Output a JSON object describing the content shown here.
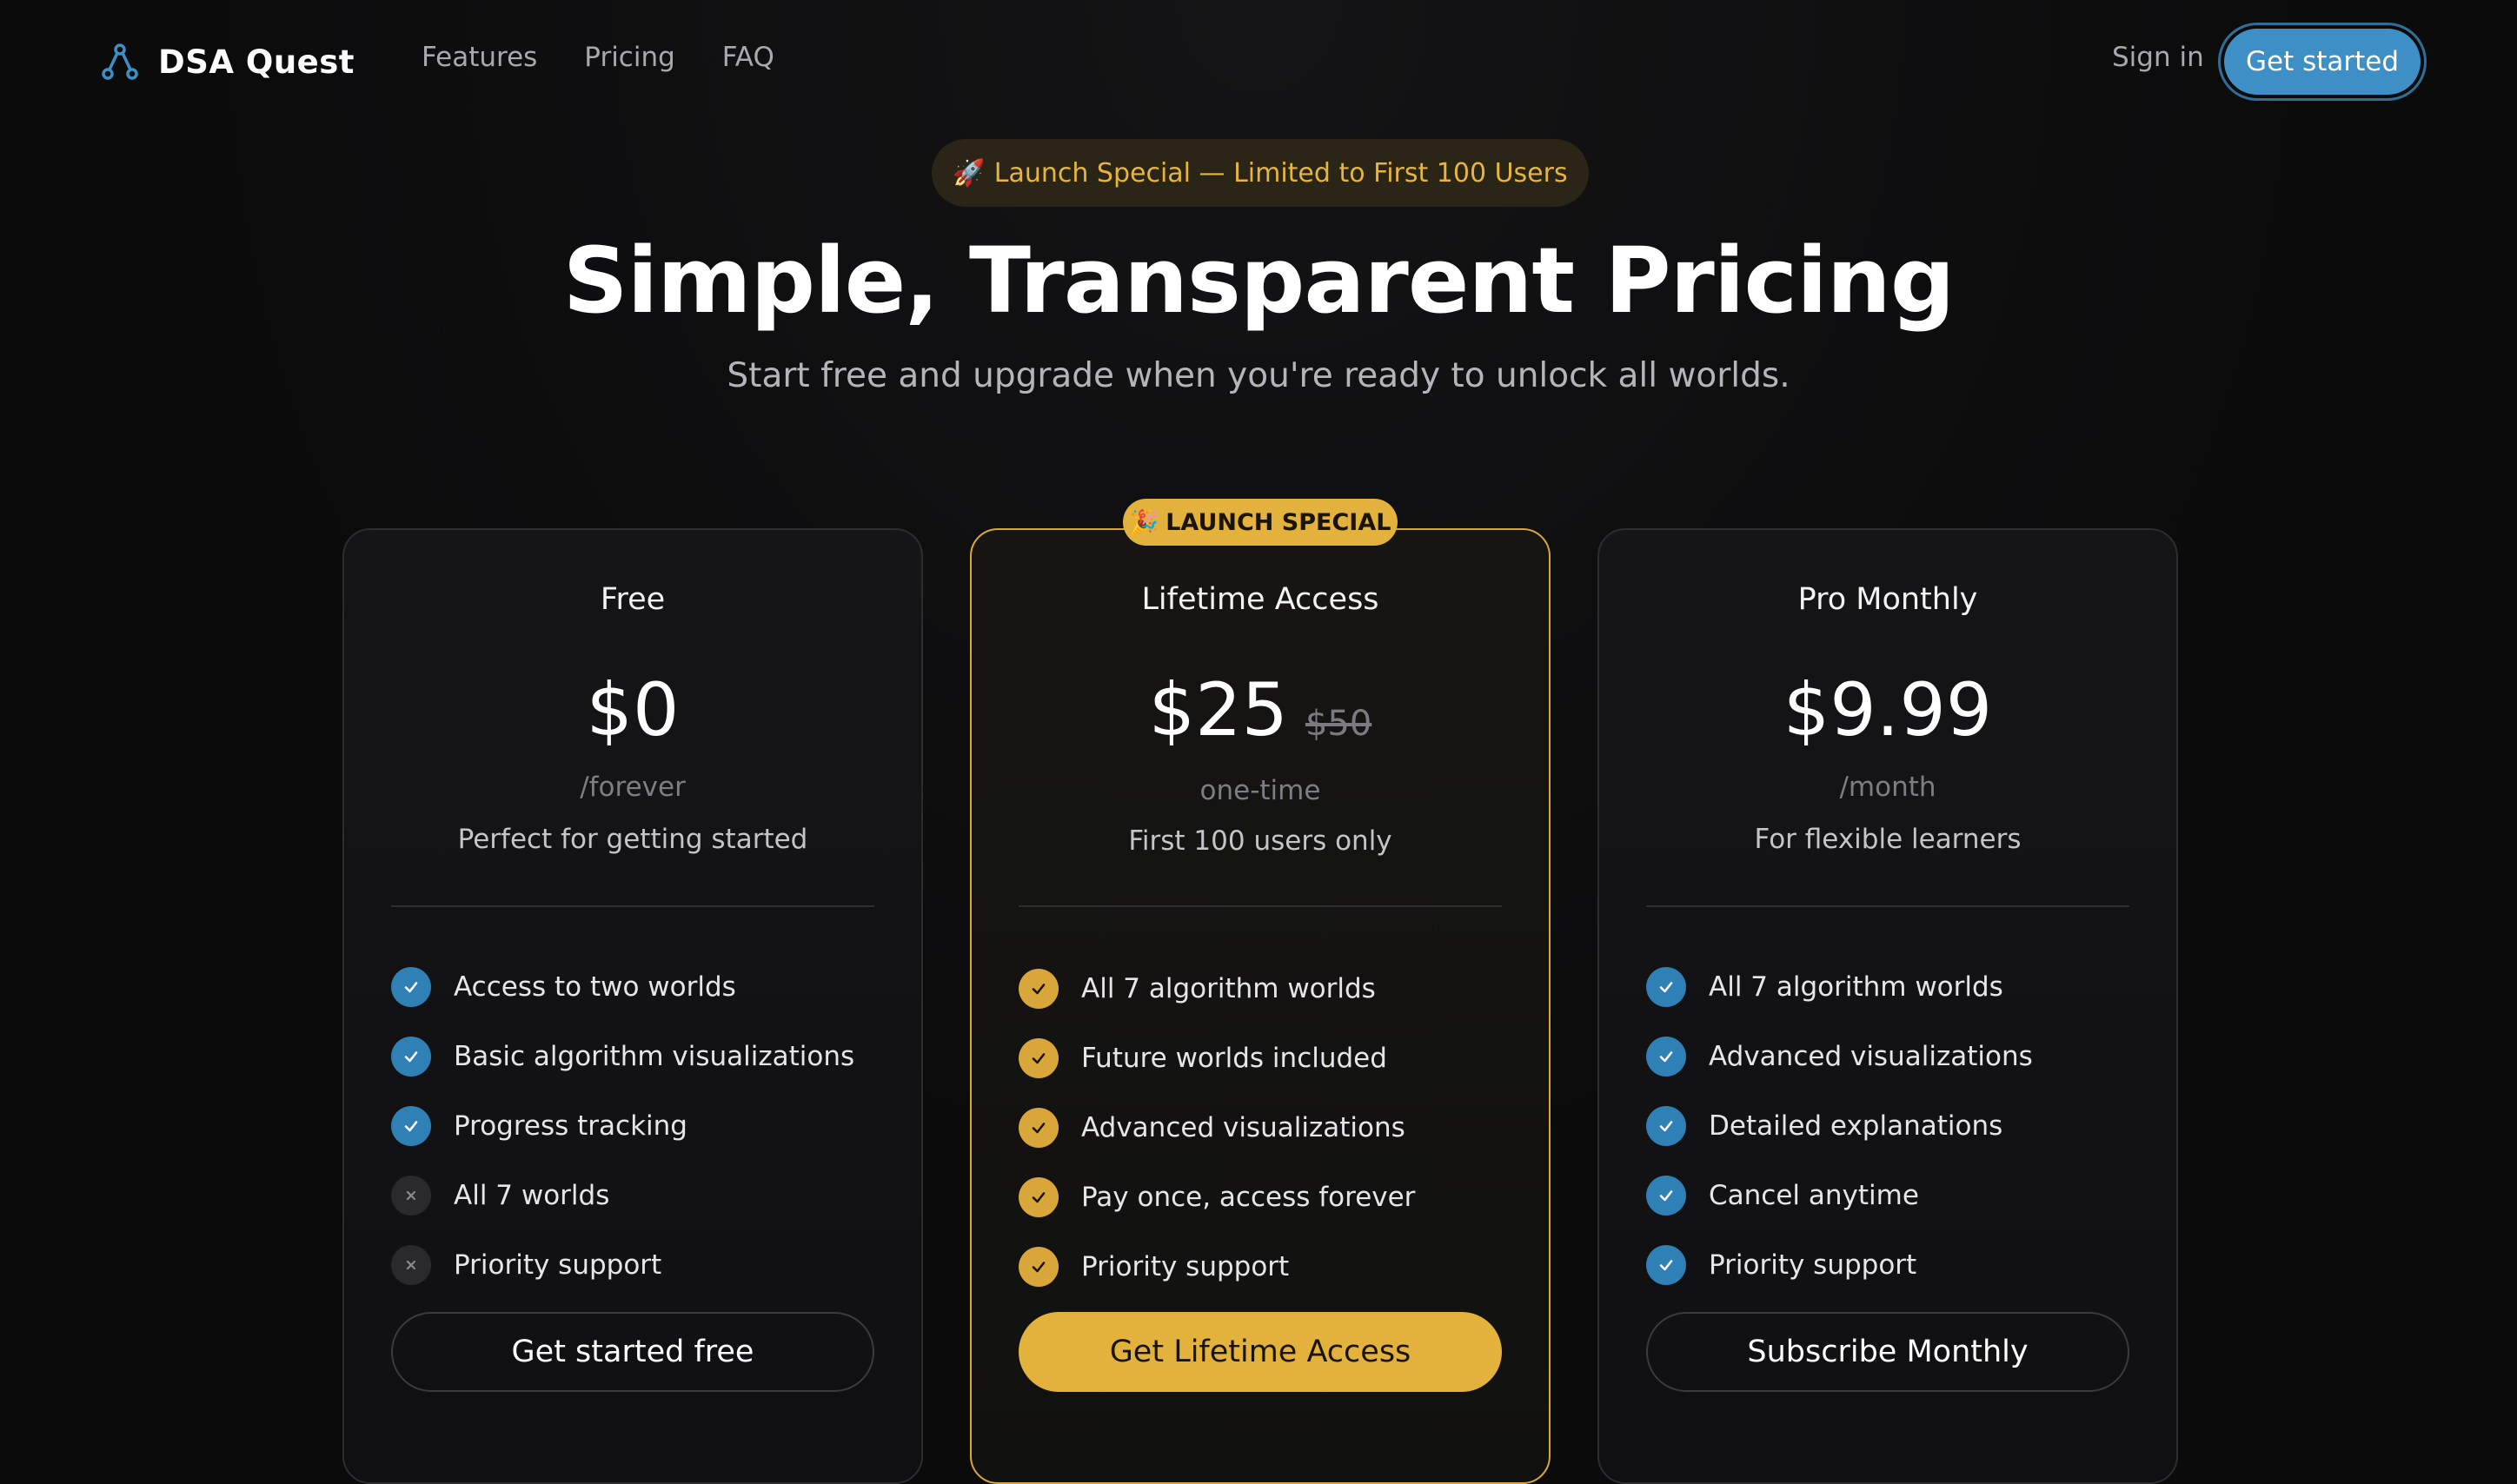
{
  "nav": {
    "brand": "DSA Quest",
    "links": [
      "Features",
      "Pricing",
      "FAQ"
    ],
    "sign_in": "Sign in",
    "get_started": "Get started"
  },
  "hero": {
    "pill_icon": "🚀",
    "pill_text": "Launch Special — Limited to First 100 Users",
    "title": "Simple, Transparent Pricing",
    "subtitle": "Start free and upgrade when you're ready to unlock all worlds."
  },
  "badge": {
    "icon": "🎉",
    "text": "LAUNCH SPECIAL"
  },
  "plans": [
    {
      "name": "Free",
      "price": "$0",
      "old_price": "",
      "period": "/forever",
      "tagline": "Perfect for getting started",
      "features": [
        {
          "label": "Access to two worlds",
          "included": true
        },
        {
          "label": "Basic algorithm visualizations",
          "included": true
        },
        {
          "label": "Progress tracking",
          "included": true
        },
        {
          "label": "All 7 worlds",
          "included": false
        },
        {
          "label": "Priority support",
          "included": false
        }
      ],
      "button": "Get started free"
    },
    {
      "name": "Lifetime Access",
      "price": "$25",
      "old_price": "$50",
      "period": "one-time",
      "tagline": "First 100 users only",
      "features": [
        {
          "label": "All 7 algorithm worlds",
          "included": true
        },
        {
          "label": "Future worlds included",
          "included": true
        },
        {
          "label": "Advanced visualizations",
          "included": true
        },
        {
          "label": "Pay once, access forever",
          "included": true
        },
        {
          "label": "Priority support",
          "included": true
        }
      ],
      "button": "Get Lifetime Access"
    },
    {
      "name": "Pro Monthly",
      "price": "$9.99",
      "old_price": "",
      "period": "/month",
      "tagline": "For flexible learners",
      "features": [
        {
          "label": "All 7 algorithm worlds",
          "included": true
        },
        {
          "label": "Advanced visualizations",
          "included": true
        },
        {
          "label": "Detailed explanations",
          "included": true
        },
        {
          "label": "Cancel anytime",
          "included": true
        },
        {
          "label": "Priority support",
          "included": true
        }
      ],
      "button": "Subscribe Monthly"
    }
  ],
  "colors": {
    "accent_blue": "#3d8fc6",
    "accent_gold": "#e3b23d",
    "background": "#0b0b0c"
  }
}
